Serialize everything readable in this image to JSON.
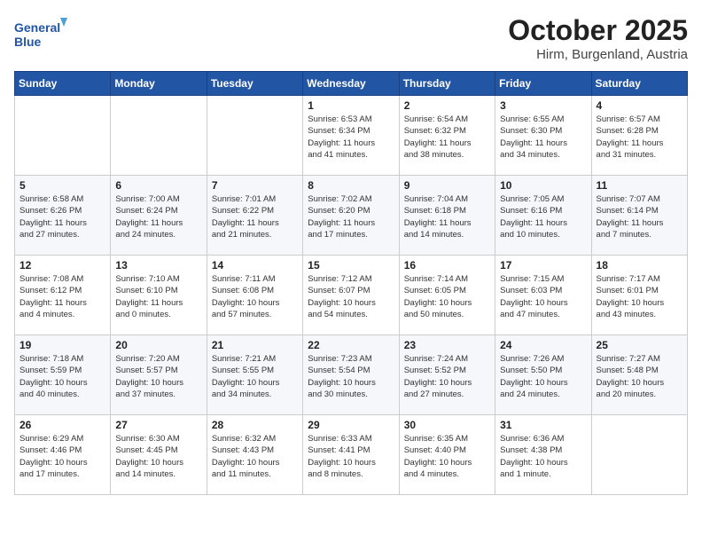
{
  "header": {
    "logo_line1": "General",
    "logo_line2": "Blue",
    "month": "October 2025",
    "location": "Hirm, Burgenland, Austria"
  },
  "days_of_week": [
    "Sunday",
    "Monday",
    "Tuesday",
    "Wednesday",
    "Thursday",
    "Friday",
    "Saturday"
  ],
  "weeks": [
    [
      {
        "day": "",
        "info": ""
      },
      {
        "day": "",
        "info": ""
      },
      {
        "day": "",
        "info": ""
      },
      {
        "day": "1",
        "info": "Sunrise: 6:53 AM\nSunset: 6:34 PM\nDaylight: 11 hours\nand 41 minutes."
      },
      {
        "day": "2",
        "info": "Sunrise: 6:54 AM\nSunset: 6:32 PM\nDaylight: 11 hours\nand 38 minutes."
      },
      {
        "day": "3",
        "info": "Sunrise: 6:55 AM\nSunset: 6:30 PM\nDaylight: 11 hours\nand 34 minutes."
      },
      {
        "day": "4",
        "info": "Sunrise: 6:57 AM\nSunset: 6:28 PM\nDaylight: 11 hours\nand 31 minutes."
      }
    ],
    [
      {
        "day": "5",
        "info": "Sunrise: 6:58 AM\nSunset: 6:26 PM\nDaylight: 11 hours\nand 27 minutes."
      },
      {
        "day": "6",
        "info": "Sunrise: 7:00 AM\nSunset: 6:24 PM\nDaylight: 11 hours\nand 24 minutes."
      },
      {
        "day": "7",
        "info": "Sunrise: 7:01 AM\nSunset: 6:22 PM\nDaylight: 11 hours\nand 21 minutes."
      },
      {
        "day": "8",
        "info": "Sunrise: 7:02 AM\nSunset: 6:20 PM\nDaylight: 11 hours\nand 17 minutes."
      },
      {
        "day": "9",
        "info": "Sunrise: 7:04 AM\nSunset: 6:18 PM\nDaylight: 11 hours\nand 14 minutes."
      },
      {
        "day": "10",
        "info": "Sunrise: 7:05 AM\nSunset: 6:16 PM\nDaylight: 11 hours\nand 10 minutes."
      },
      {
        "day": "11",
        "info": "Sunrise: 7:07 AM\nSunset: 6:14 PM\nDaylight: 11 hours\nand 7 minutes."
      }
    ],
    [
      {
        "day": "12",
        "info": "Sunrise: 7:08 AM\nSunset: 6:12 PM\nDaylight: 11 hours\nand 4 minutes."
      },
      {
        "day": "13",
        "info": "Sunrise: 7:10 AM\nSunset: 6:10 PM\nDaylight: 11 hours\nand 0 minutes."
      },
      {
        "day": "14",
        "info": "Sunrise: 7:11 AM\nSunset: 6:08 PM\nDaylight: 10 hours\nand 57 minutes."
      },
      {
        "day": "15",
        "info": "Sunrise: 7:12 AM\nSunset: 6:07 PM\nDaylight: 10 hours\nand 54 minutes."
      },
      {
        "day": "16",
        "info": "Sunrise: 7:14 AM\nSunset: 6:05 PM\nDaylight: 10 hours\nand 50 minutes."
      },
      {
        "day": "17",
        "info": "Sunrise: 7:15 AM\nSunset: 6:03 PM\nDaylight: 10 hours\nand 47 minutes."
      },
      {
        "day": "18",
        "info": "Sunrise: 7:17 AM\nSunset: 6:01 PM\nDaylight: 10 hours\nand 43 minutes."
      }
    ],
    [
      {
        "day": "19",
        "info": "Sunrise: 7:18 AM\nSunset: 5:59 PM\nDaylight: 10 hours\nand 40 minutes."
      },
      {
        "day": "20",
        "info": "Sunrise: 7:20 AM\nSunset: 5:57 PM\nDaylight: 10 hours\nand 37 minutes."
      },
      {
        "day": "21",
        "info": "Sunrise: 7:21 AM\nSunset: 5:55 PM\nDaylight: 10 hours\nand 34 minutes."
      },
      {
        "day": "22",
        "info": "Sunrise: 7:23 AM\nSunset: 5:54 PM\nDaylight: 10 hours\nand 30 minutes."
      },
      {
        "day": "23",
        "info": "Sunrise: 7:24 AM\nSunset: 5:52 PM\nDaylight: 10 hours\nand 27 minutes."
      },
      {
        "day": "24",
        "info": "Sunrise: 7:26 AM\nSunset: 5:50 PM\nDaylight: 10 hours\nand 24 minutes."
      },
      {
        "day": "25",
        "info": "Sunrise: 7:27 AM\nSunset: 5:48 PM\nDaylight: 10 hours\nand 20 minutes."
      }
    ],
    [
      {
        "day": "26",
        "info": "Sunrise: 6:29 AM\nSunset: 4:46 PM\nDaylight: 10 hours\nand 17 minutes."
      },
      {
        "day": "27",
        "info": "Sunrise: 6:30 AM\nSunset: 4:45 PM\nDaylight: 10 hours\nand 14 minutes."
      },
      {
        "day": "28",
        "info": "Sunrise: 6:32 AM\nSunset: 4:43 PM\nDaylight: 10 hours\nand 11 minutes."
      },
      {
        "day": "29",
        "info": "Sunrise: 6:33 AM\nSunset: 4:41 PM\nDaylight: 10 hours\nand 8 minutes."
      },
      {
        "day": "30",
        "info": "Sunrise: 6:35 AM\nSunset: 4:40 PM\nDaylight: 10 hours\nand 4 minutes."
      },
      {
        "day": "31",
        "info": "Sunrise: 6:36 AM\nSunset: 4:38 PM\nDaylight: 10 hours\nand 1 minute."
      },
      {
        "day": "",
        "info": ""
      }
    ]
  ]
}
